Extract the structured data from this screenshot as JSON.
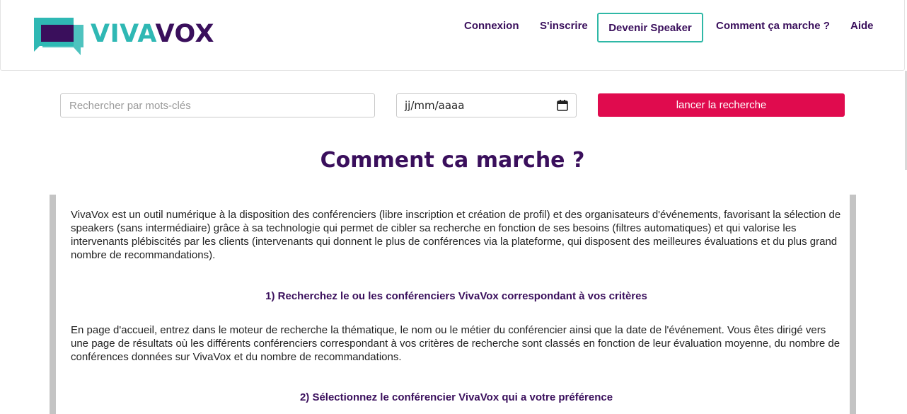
{
  "brand": {
    "part1": "VIVA",
    "part2": "VOX"
  },
  "nav": {
    "login": "Connexion",
    "signup": "S'inscrire",
    "become_speaker": "Devenir Speaker",
    "how_it_works": "Comment ça marche ?",
    "help": "Aide"
  },
  "search": {
    "keywords_placeholder": "Rechercher par mots-clés",
    "date_placeholder": "jj/mm/aaaa",
    "button": "lancer la recherche"
  },
  "page": {
    "title": "Comment ca marche ?",
    "intro": "VivaVox est un outil numérique à la disposition des conférenciers (libre inscription et création de profil) et des organisateurs d'événements, favorisant la sélection de speakers (sans intermédiaire) grâce à sa technologie qui permet de cibler sa recherche en fonction de ses besoins (filtres automatiques) et qui valorise les intervenants plébiscités par les clients (intervenants qui donnent le plus de conférences via la plateforme, qui disposent des meilleures évaluations et du plus grand nombre de recommandations).",
    "step1_title": "1) Recherchez le ou les conférenciers VivaVox correspondant à vos critères",
    "step1_text": "En page d'accueil, entrez dans le moteur de recherche la thématique, le nom ou le métier du conférencier ainsi que la date de l'événement. Vous êtes dirigé vers une page de résultats où les différents conférenciers correspondant à vos critères de recherche sont classés en fonction de leur évaluation moyenne, du nombre de conférences données sur VivaVox et du nombre de recommandations.",
    "step2_title": "2) Sélectionnez le conférencier VivaVox qui a votre préférence"
  },
  "colors": {
    "teal": "#2fb8b4",
    "purple": "#3a0f5c",
    "accent": "#e00b4e"
  }
}
